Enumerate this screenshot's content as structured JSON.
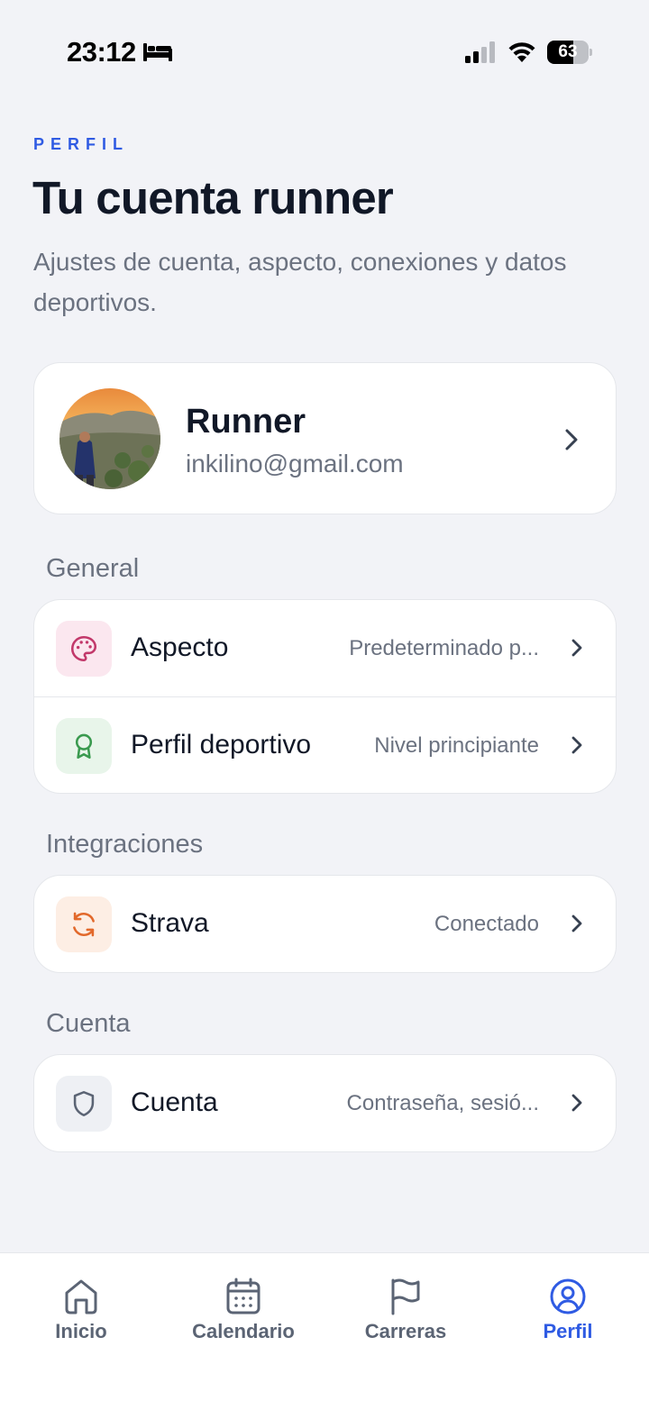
{
  "status_bar": {
    "time": "23:12",
    "battery": "63",
    "battery_fraction": 0.63,
    "icons": [
      "bed-icon",
      "signal-icon",
      "wifi-icon",
      "battery-icon"
    ]
  },
  "header": {
    "eyebrow": "PERFIL",
    "title": "Tu cuenta runner",
    "subtitle": "Ajustes de cuenta, aspecto, conexiones y datos deportivos."
  },
  "profile": {
    "name": "Runner",
    "email": "inkilino@gmail.com"
  },
  "sections": [
    {
      "title": "General",
      "rows": [
        {
          "label": "Aspecto",
          "value": "Predeterminado p...",
          "icon": "palette-icon",
          "icon_color": "#c2386a",
          "icon_bg": "#fbe7ef"
        },
        {
          "label": "Perfil deportivo",
          "value": "Nivel principiante",
          "icon": "award-icon",
          "icon_color": "#3a9a4f",
          "icon_bg": "#e8f5ea"
        }
      ]
    },
    {
      "title": "Integraciones",
      "rows": [
        {
          "label": "Strava",
          "value": "Conectado",
          "icon": "sync-icon",
          "icon_color": "#e2692b",
          "icon_bg": "#fdeee4"
        }
      ]
    },
    {
      "title": "Cuenta",
      "rows": [
        {
          "label": "Cuenta",
          "value": "Contraseña, sesió...",
          "icon": "shield-icon",
          "icon_color": "#5b6474",
          "icon_bg": "#eef0f4"
        }
      ]
    }
  ],
  "tab_bar": {
    "tabs": [
      {
        "label": "Inicio",
        "icon": "home-icon",
        "active": false
      },
      {
        "label": "Calendario",
        "icon": "calendar-icon",
        "active": false
      },
      {
        "label": "Carreras",
        "icon": "flag-icon",
        "active": false
      },
      {
        "label": "Perfil",
        "icon": "user-circle-icon",
        "active": true
      }
    ]
  },
  "colors": {
    "accent": "#2f5be3",
    "background": "#f2f3f7",
    "muted_text": "#6b7280"
  }
}
